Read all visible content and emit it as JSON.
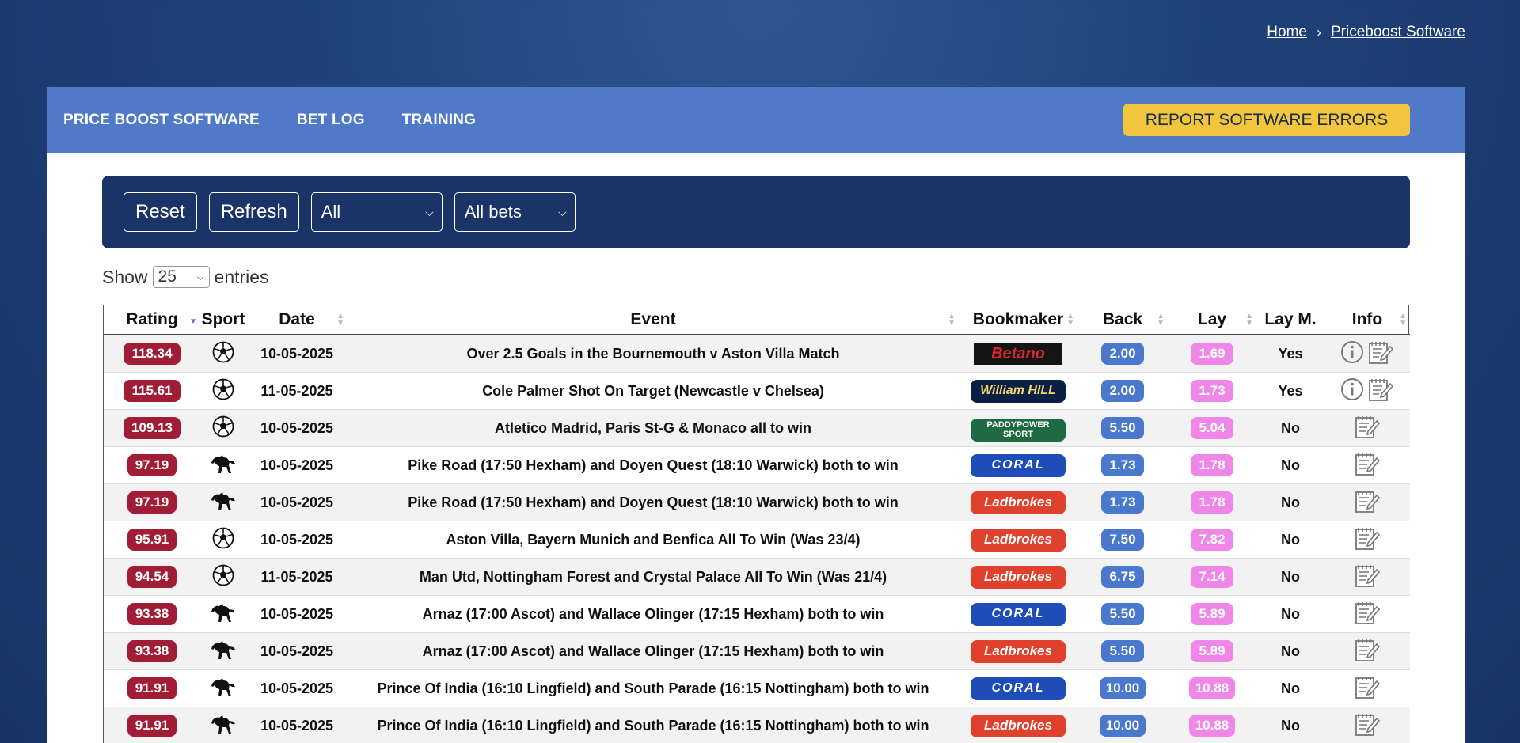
{
  "breadcrumb": {
    "home": "Home",
    "separator": "›",
    "current": "Priceboost Software"
  },
  "nav": {
    "items": [
      "PRICE BOOST SOFTWARE",
      "BET LOG",
      "TRAINING"
    ],
    "report_button": "REPORT SOFTWARE ERRORS"
  },
  "filters": {
    "reset_label": "Reset",
    "refresh_label": "Refresh",
    "sport_select": "All",
    "bet_select": "All bets"
  },
  "show_entries": {
    "prefix": "Show",
    "value": "25",
    "suffix": "entries"
  },
  "table": {
    "headers": [
      "Rating",
      "Sport",
      "Date",
      "Event",
      "Bookmaker",
      "Back",
      "Lay",
      "Lay M.",
      "Info"
    ],
    "rows": [
      {
        "rating": "118.34",
        "sport": "football-icon",
        "date": "10-05-2025",
        "event": "Over 2.5 Goals in the Bournemouth v Aston Villa Match",
        "bookmaker": "Betano",
        "bm_class": "betano",
        "back": "2.00",
        "lay": "1.69",
        "lay_m": "Yes",
        "has_info": true
      },
      {
        "rating": "115.61",
        "sport": "football-icon",
        "date": "11-05-2025",
        "event": "Cole Palmer Shot On Target (Newcastle v Chelsea)",
        "bookmaker": "William HILL",
        "bm_class": "williamhill",
        "back": "2.00",
        "lay": "1.73",
        "lay_m": "Yes",
        "has_info": true
      },
      {
        "rating": "109.13",
        "sport": "football-icon",
        "date": "10-05-2025",
        "event": "Atletico Madrid, Paris St-G & Monaco all to win",
        "bookmaker": "PADDYPOWER SPORT",
        "bm_class": "paddypower",
        "back": "5.50",
        "lay": "5.04",
        "lay_m": "No",
        "has_info": false
      },
      {
        "rating": "97.19",
        "sport": "horse-icon",
        "date": "10-05-2025",
        "event": "Pike Road (17:50 Hexham) and Doyen Quest (18:10 Warwick) both to win",
        "bookmaker": "CORAL",
        "bm_class": "coral",
        "back": "1.73",
        "lay": "1.78",
        "lay_m": "No",
        "has_info": false
      },
      {
        "rating": "97.19",
        "sport": "horse-icon",
        "date": "10-05-2025",
        "event": "Pike Road (17:50 Hexham) and Doyen Quest (18:10 Warwick) both to win",
        "bookmaker": "Ladbrokes",
        "bm_class": "ladbrokes",
        "back": "1.73",
        "lay": "1.78",
        "lay_m": "No",
        "has_info": false
      },
      {
        "rating": "95.91",
        "sport": "football-icon",
        "date": "10-05-2025",
        "event": "Aston Villa, Bayern Munich and Benfica All To Win (Was 23/4)",
        "bookmaker": "Ladbrokes",
        "bm_class": "ladbrokes",
        "back": "7.50",
        "lay": "7.82",
        "lay_m": "No",
        "has_info": false
      },
      {
        "rating": "94.54",
        "sport": "football-icon",
        "date": "11-05-2025",
        "event": "Man Utd, Nottingham Forest and Crystal Palace All To Win (Was 21/4)",
        "bookmaker": "Ladbrokes",
        "bm_class": "ladbrokes",
        "back": "6.75",
        "lay": "7.14",
        "lay_m": "No",
        "has_info": false
      },
      {
        "rating": "93.38",
        "sport": "horse-icon",
        "date": "10-05-2025",
        "event": "Arnaz (17:00 Ascot) and Wallace Olinger (17:15 Hexham) both to win",
        "bookmaker": "CORAL",
        "bm_class": "coral",
        "back": "5.50",
        "lay": "5.89",
        "lay_m": "No",
        "has_info": false
      },
      {
        "rating": "93.38",
        "sport": "horse-icon",
        "date": "10-05-2025",
        "event": "Arnaz (17:00 Ascot) and Wallace Olinger (17:15 Hexham) both to win",
        "bookmaker": "Ladbrokes",
        "bm_class": "ladbrokes",
        "back": "5.50",
        "lay": "5.89",
        "lay_m": "No",
        "has_info": false
      },
      {
        "rating": "91.91",
        "sport": "horse-icon",
        "date": "10-05-2025",
        "event": "Prince Of India (16:10 Lingfield) and South Parade (16:15 Nottingham) both to win",
        "bookmaker": "CORAL",
        "bm_class": "coral",
        "back": "10.00",
        "lay": "10.88",
        "lay_m": "No",
        "has_info": false
      },
      {
        "rating": "91.91",
        "sport": "horse-icon",
        "date": "10-05-2025",
        "event": "Prince Of India (16:10 Lingfield) and South Parade (16:15 Nottingham) both to win",
        "bookmaker": "Ladbrokes",
        "bm_class": "ladbrokes",
        "back": "10.00",
        "lay": "10.88",
        "lay_m": "No",
        "has_info": false
      }
    ]
  }
}
